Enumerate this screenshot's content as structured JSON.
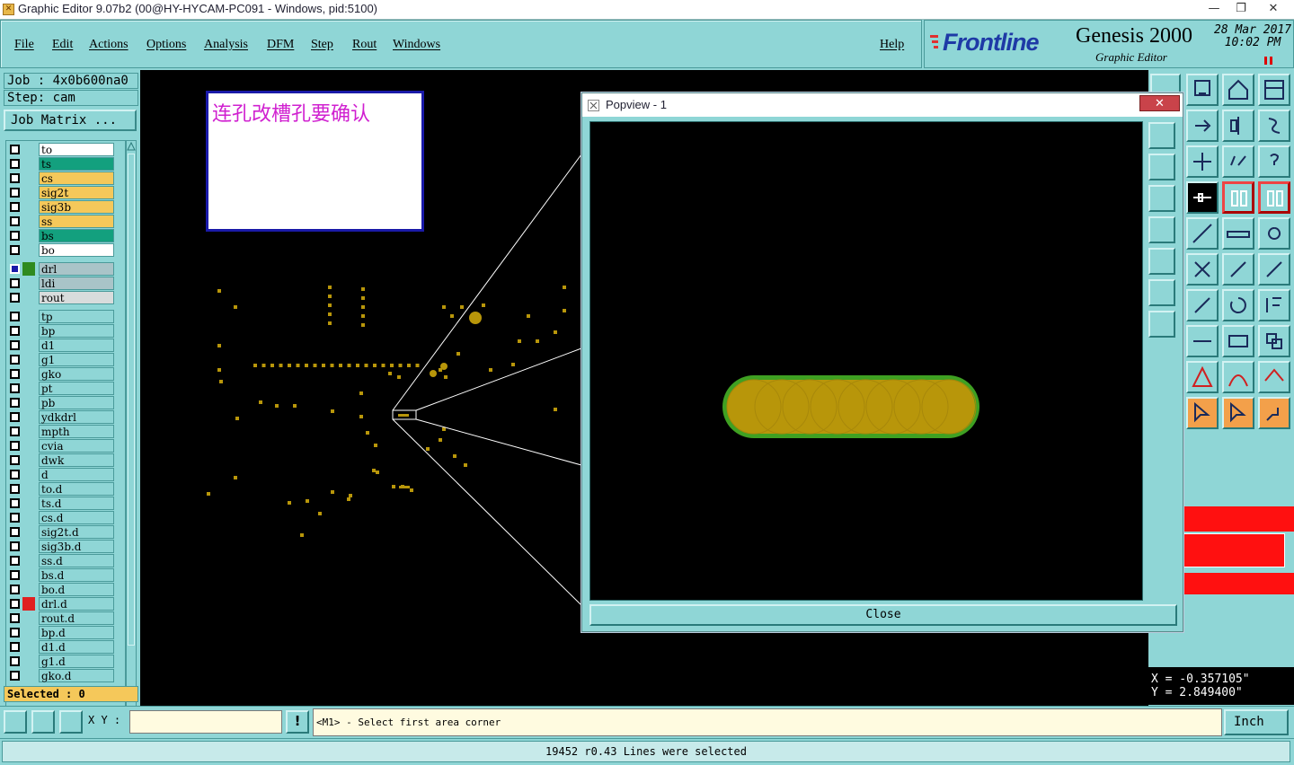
{
  "window": {
    "title": "Graphic Editor 9.07b2 (00@HY-HYCAM-PC091 - Windows, pid:5100)",
    "minimize": "—",
    "restore": "❐",
    "close": "✕"
  },
  "menu": {
    "items": [
      "File",
      "Edit",
      "Actions",
      "Options",
      "Analysis",
      "DFM",
      "Step",
      "Rout",
      "Windows"
    ],
    "help": "Help"
  },
  "brand": {
    "logo": "Frontline",
    "product": "Genesis 2000",
    "subtitle": "Graphic Editor",
    "date": "28 Mar 2017",
    "time": "10:02 PM"
  },
  "job": {
    "job_line": "Job : 4x0b600na0",
    "step_line": "Step: cam",
    "matrix_button": "Job Matrix ..."
  },
  "layers": [
    {
      "name": "to",
      "color": "#ffffff"
    },
    {
      "name": "ts",
      "color": "#13a07e"
    },
    {
      "name": "cs",
      "color": "#f5c85a"
    },
    {
      "name": "sig2t",
      "color": "#f5c85a"
    },
    {
      "name": "sig3b",
      "color": "#f5c85a"
    },
    {
      "name": "ss",
      "color": "#f5c85a"
    },
    {
      "name": "bs",
      "color": "#13a07e"
    },
    {
      "name": "bo",
      "color": "#ffffff"
    },
    {
      "name": "drl",
      "color": "#a9c4c8",
      "swatch": "#2f8a1f",
      "active": true
    },
    {
      "name": "ldi",
      "color": "#a9c4c8"
    },
    {
      "name": "rout",
      "color": "#d8dcdc"
    },
    {
      "name": "tp",
      "color": "#8fd6d6"
    },
    {
      "name": "bp",
      "color": "#8fd6d6"
    },
    {
      "name": "d1",
      "color": "#8fd6d6"
    },
    {
      "name": "g1",
      "color": "#8fd6d6"
    },
    {
      "name": "gko",
      "color": "#8fd6d6"
    },
    {
      "name": "pt",
      "color": "#8fd6d6"
    },
    {
      "name": "pb",
      "color": "#8fd6d6"
    },
    {
      "name": "ydkdrl",
      "color": "#8fd6d6"
    },
    {
      "name": "mpth",
      "color": "#8fd6d6"
    },
    {
      "name": "cvia",
      "color": "#8fd6d6"
    },
    {
      "name": "dwk",
      "color": "#8fd6d6"
    },
    {
      "name": "d",
      "color": "#8fd6d6"
    },
    {
      "name": "to.d",
      "color": "#8fd6d6"
    },
    {
      "name": "ts.d",
      "color": "#8fd6d6"
    },
    {
      "name": "cs.d",
      "color": "#8fd6d6"
    },
    {
      "name": "sig2t.d",
      "color": "#8fd6d6"
    },
    {
      "name": "sig3b.d",
      "color": "#8fd6d6"
    },
    {
      "name": "ss.d",
      "color": "#8fd6d6"
    },
    {
      "name": "bs.d",
      "color": "#8fd6d6"
    },
    {
      "name": "bo.d",
      "color": "#8fd6d6"
    },
    {
      "name": "drl.d",
      "color": "#8fd6d6",
      "swatch": "#e02020"
    },
    {
      "name": "rout.d",
      "color": "#8fd6d6"
    },
    {
      "name": "bp.d",
      "color": "#8fd6d6"
    },
    {
      "name": "d1.d",
      "color": "#8fd6d6"
    },
    {
      "name": "g1.d",
      "color": "#8fd6d6"
    },
    {
      "name": "gko.d",
      "color": "#8fd6d6"
    }
  ],
  "selected": "Selected : 0",
  "note": "连孔改槽孔要确认",
  "popview": {
    "title": "Popview - 1",
    "close_button": "Close",
    "close_x": "✕"
  },
  "coords": {
    "x": "X = -0.357105\"",
    "y": "Y = 2.849400\""
  },
  "command": {
    "xy_label": "X Y :",
    "xy_value": "",
    "prompt": "<M1> - Select first area corner",
    "unit": "Inch"
  },
  "status": "19452 r0.43 Lines were selected",
  "colors": {
    "panel": "#8fd6d6",
    "pad": "#b8960a",
    "slot_outline": "#3fa022",
    "note_text": "#d020d0"
  }
}
